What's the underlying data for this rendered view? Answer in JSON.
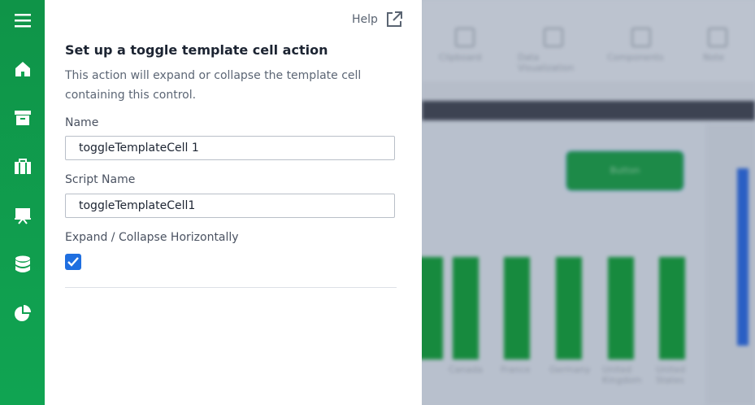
{
  "nav": {
    "items": [
      "menu-icon",
      "home-icon",
      "archive-icon",
      "portfolio-icon",
      "presentation-icon",
      "database-icon",
      "pie-chart-icon"
    ],
    "accent": "#0f9448"
  },
  "panel": {
    "help_label": "Help",
    "title": "Set up a toggle template cell action",
    "description": "This action will expand or collapse the template cell containing this control.",
    "name_label": "Name",
    "name_value": "toggleTemplateCell 1",
    "script_label": "Script Name",
    "script_value": "toggleTemplateCell1",
    "expand_label": "Expand / Collapse Horizontally",
    "expand_checked": true
  },
  "background": {
    "toolbar": [
      "Clipboard",
      "Data Visualization",
      "Components",
      "Note"
    ],
    "button_text": "Button",
    "categories": [
      "Canada",
      "France",
      "Germany",
      "United Kingdom",
      "United States"
    ],
    "bar_color": "#178a3e"
  }
}
